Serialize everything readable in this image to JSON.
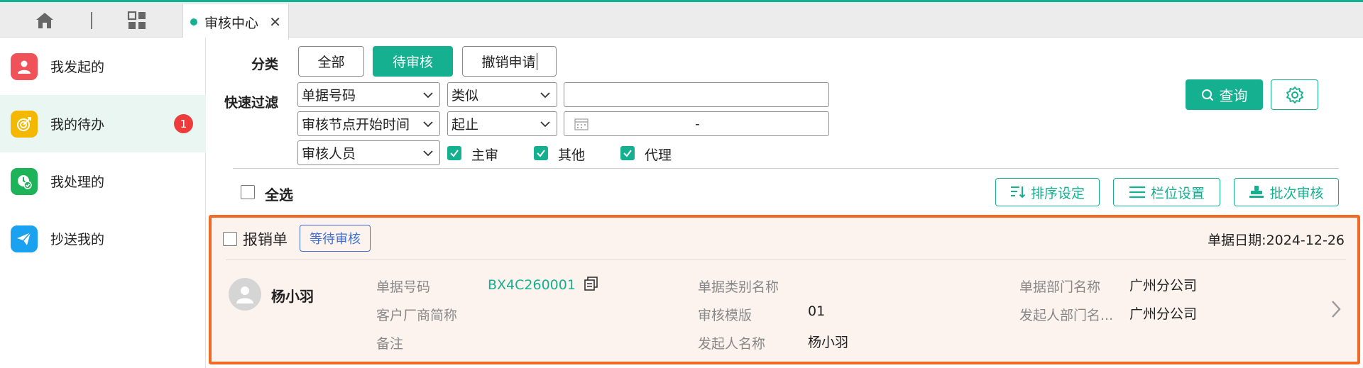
{
  "tabs": [
    {
      "label": "审核中心"
    }
  ],
  "sidebar": {
    "items": [
      {
        "label": "我发起的",
        "color": "#f0525a"
      },
      {
        "label": "我的待办",
        "color": "#f5b800",
        "badge": "1"
      },
      {
        "label": "我处理的",
        "color": "#1db358"
      },
      {
        "label": "抄送我的",
        "color": "#1aa1f0"
      }
    ]
  },
  "filter": {
    "category_label": "分类",
    "categories": [
      "全部",
      "待审核",
      "撤销申请"
    ],
    "quick_label": "快速过滤",
    "row1": {
      "field": "单据号码",
      "op": "类似",
      "value": ""
    },
    "row2": {
      "field": "审核节点开始时间",
      "op": "起止",
      "range_sep": "-"
    },
    "row3": {
      "field": "审核人员",
      "checks": [
        "主审",
        "其他",
        "代理"
      ]
    },
    "query_label": "查询"
  },
  "toolbar": {
    "select_all": "全选",
    "sort": "排序设定",
    "columns": "栏位设置",
    "batch": "批次审核"
  },
  "record": {
    "type": "报销单",
    "status": "等待审核",
    "date": "单据日期:2024-12-26",
    "person": "杨小羽",
    "fields": {
      "doc_no_label": "单据号码",
      "doc_no": "BX4C260001",
      "customer_label": "客户厂商简称",
      "customer": "",
      "remark_label": "备注",
      "remark": "",
      "category_label": "单据类别名称",
      "category": "",
      "template_label": "审核模版",
      "template": "01",
      "initiator_label": "发起人名称",
      "initiator": "杨小羽",
      "dept_label": "单据部门名称",
      "dept": "广州分公司",
      "initiator_dept_label": "发起人部门名...",
      "initiator_dept": "广州分公司"
    }
  },
  "colors": {
    "accent": "#14b090",
    "highlight": "#f06a25",
    "tag": "#3f6fd6"
  }
}
